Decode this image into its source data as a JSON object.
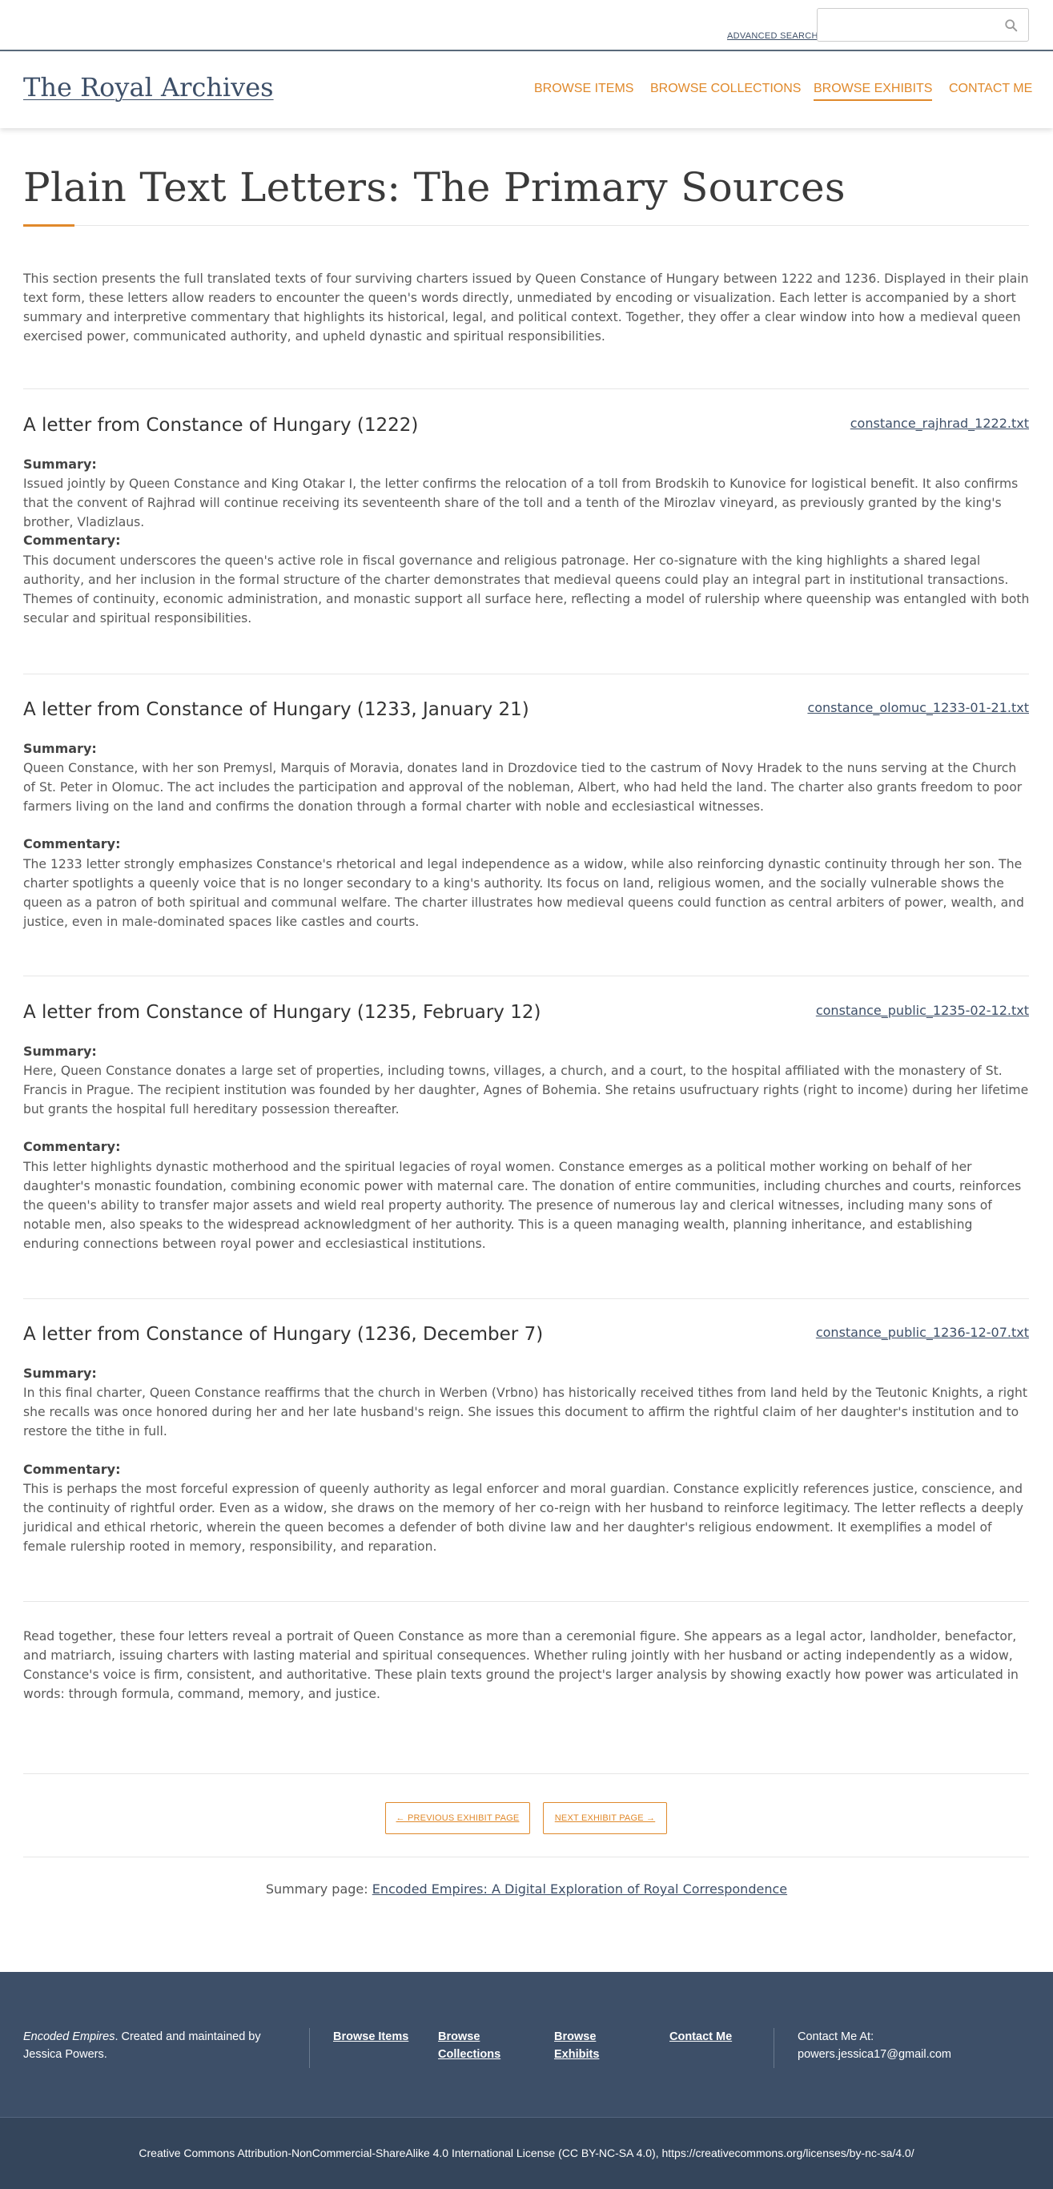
{
  "topbar": {
    "advanced_search": "ADVANCED SEARCH",
    "search_placeholder": ""
  },
  "header": {
    "site_title": "The Royal Archives",
    "nav": [
      {
        "label": "BROWSE ITEMS",
        "active": false
      },
      {
        "label": "BROWSE COLLECTIONS",
        "active": false
      },
      {
        "label": "BROWSE EXHIBITS",
        "active": true
      },
      {
        "label": "CONTACT ME",
        "active": false
      }
    ]
  },
  "page": {
    "title": "Plain Text Letters: The Primary Sources",
    "intro": "This section presents the full translated texts of four surviving charters issued by Queen Constance of Hungary between 1222 and 1236. Displayed in their plain text form, these letters allow readers to encounter the queen's words directly, unmediated by encoding or visualization. Each letter is accompanied by a short summary and interpretive commentary that highlights its historical, legal, and political context. Together, they offer a clear window into how a medieval queen exercised power, communicated authority, and upheld dynastic and spiritual responsibilities.",
    "summary_label": "Summary:",
    "commentary_label": "Commentary:",
    "letters": [
      {
        "title": "A letter from Constance of Hungary (1222)",
        "file": "constance_rajhrad_1222.txt",
        "summary": "Issued jointly by Queen Constance and King Otakar I, the letter confirms the relocation of a toll from Brodskih to Kunovice for logistical benefit. It also confirms that the convent of Rajhrad will continue receiving its seventeenth share of the toll and a tenth of the Mirozlav vineyard, as previously granted by the king's brother, Vladizlaus.",
        "commentary": "This document underscores the queen's active role in fiscal governance and religious patronage. Her co-signature with the king highlights a shared legal authority, and her inclusion in the formal structure of the charter demonstrates that medieval queens could play an integral part in institutional transactions. Themes of continuity, economic administration, and monastic support all surface here, reflecting a model of rulership where queenship was entangled with both secular and spiritual responsibilities."
      },
      {
        "title": "A letter from Constance of Hungary (1233, January 21)",
        "file": "constance_olomuc_1233-01-21.txt",
        "summary": "Queen Constance, with her son Premysl, Marquis of Moravia, donates land in Drozdovice tied to the castrum of Novy Hradek to the nuns serving at the Church of St. Peter in Olomuc. The act includes the participation and approval of the nobleman, Albert, who had held the land. The charter also grants freedom to poor farmers living on the land and confirms the donation through a formal charter with noble and ecclesiastical witnesses.",
        "commentary": "The 1233 letter strongly emphasizes Constance's rhetorical and legal independence as a widow, while also reinforcing dynastic continuity through her son. The charter spotlights a queenly voice that is no longer secondary to a king's authority. Its focus on land, religious women, and the socially vulnerable shows the queen as a patron of both spiritual and communal welfare. The charter illustrates how medieval queens could function as central arbiters of power, wealth, and justice, even in male-dominated spaces like castles and courts."
      },
      {
        "title": "A letter from Constance of Hungary (1235, February 12)",
        "file": "constance_public_1235-02-12.txt",
        "summary": "Here, Queen Constance donates a large set of properties, including towns, villages, a church, and a court, to the hospital affiliated with the monastery of St. Francis in Prague. The recipient institution was founded by her daughter, Agnes of Bohemia. She retains usufructuary rights (right to income) during her lifetime but grants the hospital full hereditary possession thereafter.",
        "commentary": "This letter highlights dynastic motherhood and the spiritual legacies of royal women. Constance emerges as a political mother working on behalf of her daughter's monastic foundation, combining economic power with maternal care. The donation of entire communities, including churches and courts, reinforces the queen's ability to transfer major assets and wield real property authority. The presence of numerous lay and clerical witnesses, including many sons of notable men, also speaks to the widespread acknowledgment of her authority. This is a queen managing wealth, planning inheritance, and establishing enduring connections between royal power and ecclesiastical institutions."
      },
      {
        "title": "A letter from Constance of Hungary (1236, December 7)",
        "file": "constance_public_1236-12-07.txt",
        "summary": "In this final charter, Queen Constance reaffirms that the church in Werben (Vrbno) has historically received tithes from land held by the Teutonic Knights, a right she recalls was once honored during her and her late husband's reign. She issues this document to affirm the rightful claim of her daughter's institution and to restore the tithe in full.",
        "commentary": "This is perhaps the most forceful expression of queenly authority as legal enforcer and moral guardian. Constance explicitly references justice, conscience, and the continuity of rightful order. Even as a widow, she draws on the memory of her co-reign with her husband to reinforce legitimacy. The letter reflects a deeply juridical and ethical rhetoric, wherein the queen becomes a defender of both divine law and her daughter's religious endowment. It exemplifies a model of female rulership rooted in memory, responsibility, and reparation."
      }
    ],
    "conclusion": "Read together, these four letters reveal a portrait of Queen Constance as more than a ceremonial figure. She appears as a legal actor, landholder, benefactor, and matriarch, issuing charters with lasting material and spiritual consequences. Whether ruling jointly with her husband or acting independently as a widow, Constance's voice is firm, consistent, and authoritative. These plain texts ground the project's larger analysis by showing exactly how power was articulated in words: through formula, command, memory, and justice.",
    "prev_button": "← PREVIOUS EXHIBIT PAGE",
    "next_button": "NEXT EXHIBIT PAGE →",
    "summary_prefix": "Summary page: ",
    "summary_link": "Encoded Empires: A Digital Exploration of Royal Correspondence"
  },
  "footer": {
    "credit_italic": "Encoded Empires",
    "credit_rest": ". Created and maintained by Jessica Powers.",
    "links": [
      "Browse Items",
      "Browse Collections",
      "Browse Exhibits",
      "Contact Me"
    ],
    "contact_label": "Contact Me At:",
    "contact_email": "powers.jessica17@gmail.com",
    "license": "Creative Commons Attribution-NonCommercial-ShareAlike 4.0 International License (CC BY-NC-SA 4.0), https://creativecommons.org/licenses/by-nc-sa/4.0/"
  },
  "colors": {
    "accent": "#e0892b",
    "navy": "#3d4f68",
    "footer_bg": "#3d4f68"
  }
}
